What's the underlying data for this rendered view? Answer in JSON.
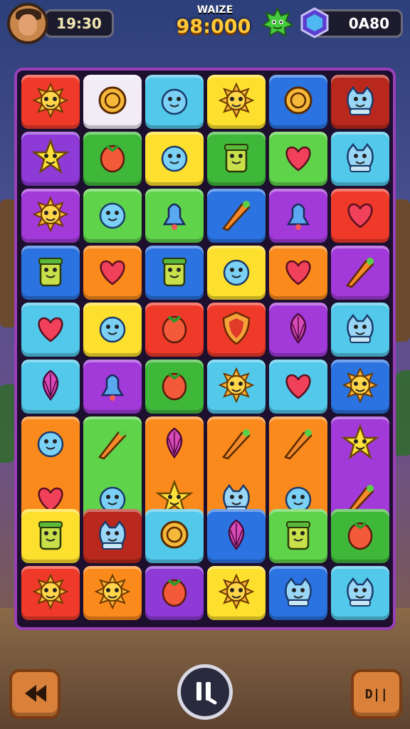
{
  "hud": {
    "timer": "19:30",
    "score_label": "WAIZE",
    "score_value": "98:000",
    "gems": "0A80"
  },
  "colors": {
    "red": "#ef3a2a",
    "white": "#f1ecf6",
    "cyan": "#52c8ea",
    "yellow": "#fde02e",
    "blue": "#2a73e0",
    "darkred": "#b8281c",
    "purple": "#8d3ad6",
    "green": "#3fb83a",
    "lime": "#5fd34a",
    "orange": "#fb8a1c",
    "violet": "#a13ad8",
    "board_border": "#9a3fb8"
  },
  "tiles": [
    {
      "color": "red",
      "icon": "sun-face-icon"
    },
    {
      "color": "white",
      "icon": "pie-icon"
    },
    {
      "color": "cyan",
      "icon": "turtle-icon"
    },
    {
      "color": "yellow",
      "icon": "sunflower-icon"
    },
    {
      "color": "blue",
      "icon": "orange-fruit-icon"
    },
    {
      "color": "darkred",
      "icon": "bowl-icon"
    },
    {
      "color": "purple",
      "icon": "star-face-icon"
    },
    {
      "color": "green",
      "icon": "strawberry-icon"
    },
    {
      "color": "yellow",
      "icon": "winged-crest-icon"
    },
    {
      "color": "green",
      "icon": "jar-icon"
    },
    {
      "color": "lime",
      "icon": "heart-icon"
    },
    {
      "color": "cyan",
      "icon": "pig-icon"
    },
    {
      "color": "violet",
      "icon": "flower-creature-icon"
    },
    {
      "color": "lime",
      "icon": "sheep-icon"
    },
    {
      "color": "lime",
      "icon": "bell-pepper-icon"
    },
    {
      "color": "blue",
      "icon": "carrot-icon"
    },
    {
      "color": "violet",
      "icon": "bell-icon"
    },
    {
      "color": "red",
      "icon": "heart-pin-icon"
    },
    {
      "color": "blue",
      "icon": "house-box-icon"
    },
    {
      "color": "orange",
      "icon": "heart-outline-icon"
    },
    {
      "color": "blue",
      "icon": "popcorn-icon"
    },
    {
      "color": "yellow",
      "icon": "smiley-icon"
    },
    {
      "color": "orange",
      "icon": "heart-icon"
    },
    {
      "color": "violet",
      "icon": "pickaxe-icon"
    },
    {
      "color": "cyan",
      "icon": "heart-icon"
    },
    {
      "color": "yellow",
      "icon": "blob-creature-icon"
    },
    {
      "color": "red",
      "icon": "lemon-icon"
    },
    {
      "color": "red",
      "icon": "shield-icon"
    },
    {
      "color": "violet",
      "icon": "squid-icon"
    },
    {
      "color": "cyan",
      "icon": "cat-icon"
    },
    {
      "color": "cyan",
      "icon": "cupcake-icon"
    },
    {
      "color": "violet",
      "icon": "bell-icon"
    },
    {
      "color": "green",
      "icon": "leaf-icon"
    },
    {
      "color": "cyan",
      "icon": "sun-face-icon"
    },
    {
      "color": "cyan",
      "icon": "heart-flower-icon"
    },
    {
      "color": "blue",
      "icon": "sun-face-icon"
    },
    {
      "color": "orange",
      "icon": "fish-heart-icon",
      "tall": true
    },
    {
      "color": "lime",
      "icon": "feather-berry-icon",
      "tall": true
    },
    {
      "color": "orange",
      "icon": "balloon-star-icon",
      "tall": true
    },
    {
      "color": "orange",
      "icon": "feather-cat-icon",
      "tall": true
    },
    {
      "color": "orange",
      "icon": "pepper-brush-icon",
      "tall": true
    },
    {
      "color": "violet",
      "icon": "star-wand-icon",
      "tall": true
    },
    {
      "color": "yellow",
      "icon": "cookie-face-icon"
    },
    {
      "color": "darkred",
      "icon": "octopus-icon"
    },
    {
      "color": "cyan",
      "icon": "ring-icon"
    },
    {
      "color": "blue",
      "icon": "shell-icon"
    },
    {
      "color": "lime",
      "icon": "boot-icon"
    },
    {
      "color": "green",
      "icon": "watermelon-icon"
    },
    {
      "color": "red",
      "icon": "flower-creature-icon"
    },
    {
      "color": "orange",
      "icon": "cabbage-icon"
    },
    {
      "color": "purple",
      "icon": "radish-icon"
    },
    {
      "color": "yellow",
      "icon": "rose-icon"
    },
    {
      "color": "blue",
      "icon": "owl-icon"
    },
    {
      "color": "cyan",
      "icon": "cat-icon"
    }
  ],
  "controls": {
    "back": "back-icon",
    "pause": "pause-icon",
    "menu_label": "D||"
  }
}
